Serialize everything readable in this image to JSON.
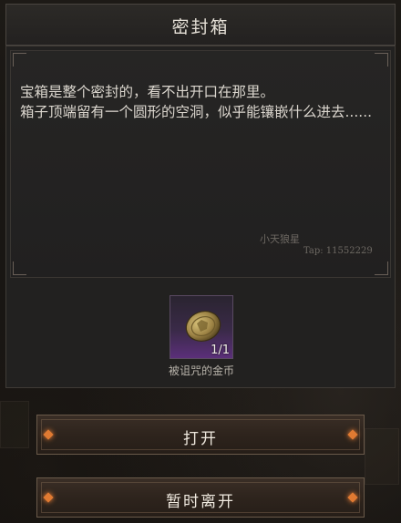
{
  "dialog": {
    "title": "密封箱",
    "description": "宝箱是整个密封的，看不出开口在那里。\n箱子顶端留有一个圆形的空洞，似乎能镶嵌什么进去......"
  },
  "watermark": {
    "name": "小天狼星",
    "tap": "Tap: 11552229"
  },
  "item": {
    "icon": "cursed-gold-coin-icon",
    "count": "1/1",
    "name": "被诅咒的金币"
  },
  "buttons": {
    "open_label": "打开",
    "leave_label": "暂时离开"
  },
  "colors": {
    "accent": "#e07a32",
    "item_rarity": "#5b2f7a"
  }
}
